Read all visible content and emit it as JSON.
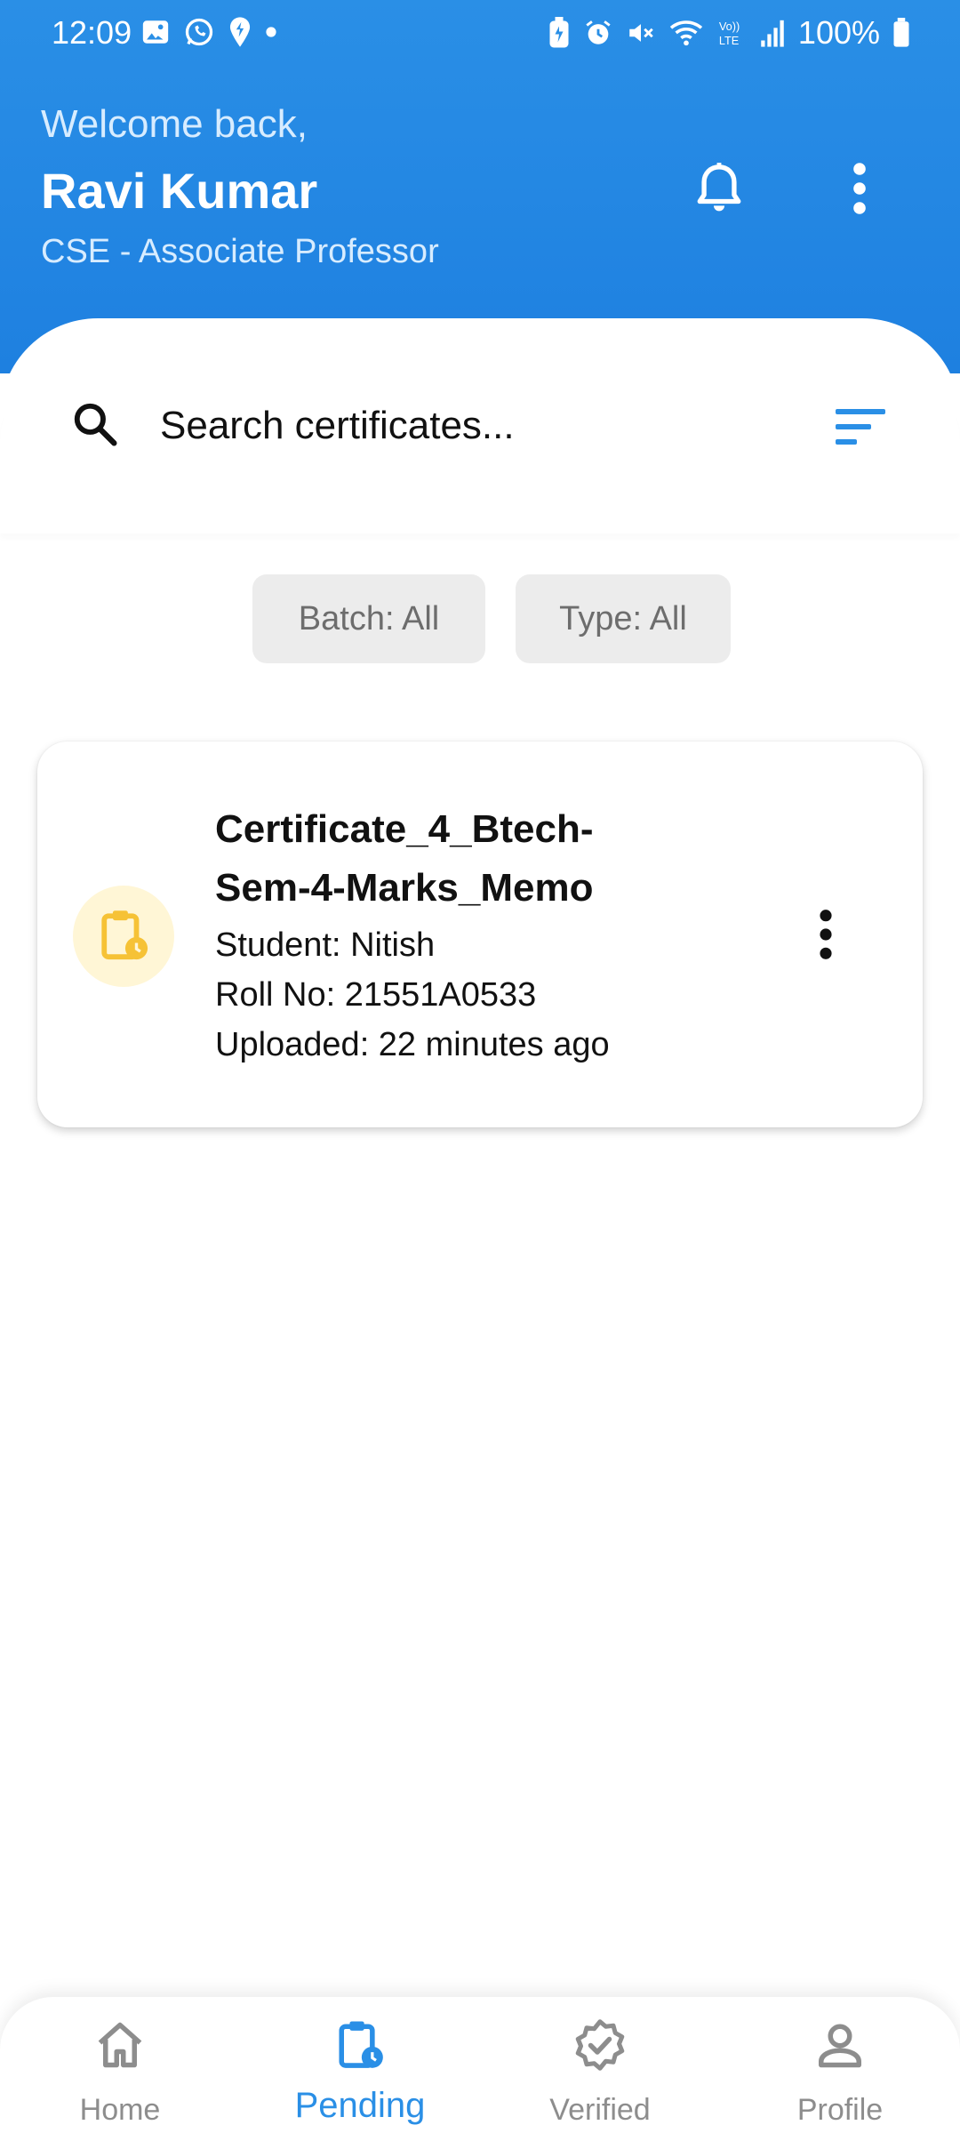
{
  "status_bar": {
    "time": "12:09",
    "battery": "100%",
    "left_icons": [
      "gallery-icon",
      "whatsapp-icon",
      "app-notification-icon",
      "dot-icon"
    ],
    "right_icons": [
      "battery-saver-icon",
      "alarm-icon",
      "mute-icon",
      "wifi-icon",
      "volte-icon",
      "signal-icon",
      "battery-icon"
    ]
  },
  "header": {
    "welcome": "Welcome back,",
    "name": "Ravi Kumar",
    "role": "CSE - Associate Professor",
    "accent_color": "#2a8fe6"
  },
  "search": {
    "placeholder": "Search certificates...",
    "value": ""
  },
  "filters": {
    "batch": "Batch: All",
    "type": "Type: All"
  },
  "certificates": [
    {
      "title": "Certificate_4_Btech-Sem-4-Marks_Memo",
      "student": "Student: Nitish",
      "roll_no": "Roll No: 21551A0533",
      "uploaded": "Uploaded: 22 minutes ago",
      "status_icon": "pending-clipboard-icon",
      "status_color": "#f6c236"
    }
  ],
  "bottom_nav": {
    "active": "Pending",
    "items": [
      {
        "label": "Home",
        "icon": "home-icon"
      },
      {
        "label": "Pending",
        "icon": "pending-clipboard-icon"
      },
      {
        "label": "Verified",
        "icon": "verified-badge-icon"
      },
      {
        "label": "Profile",
        "icon": "person-icon"
      }
    ]
  }
}
